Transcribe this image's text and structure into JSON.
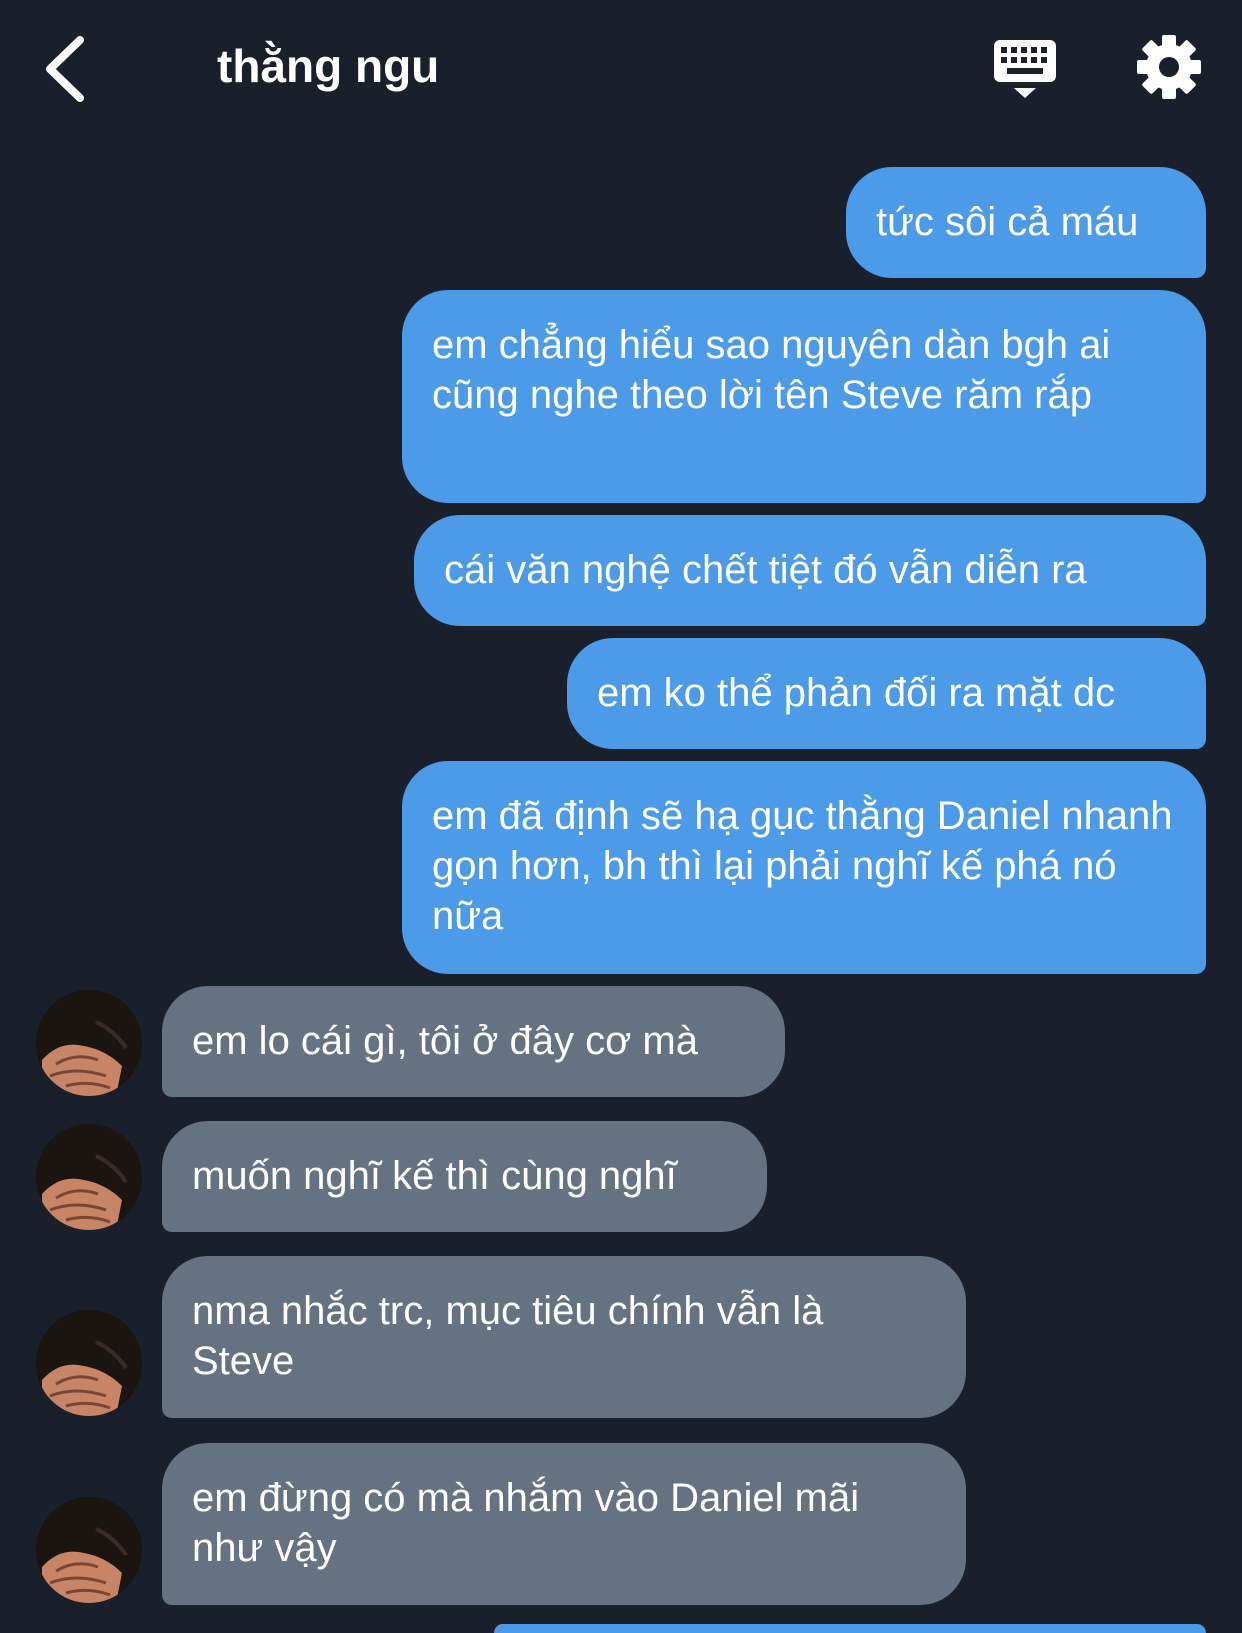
{
  "header": {
    "title": "thằng ngu",
    "back_icon": "chevron-left-icon",
    "keyboard_icon": "keyboard-icon",
    "settings_icon": "gear-icon"
  },
  "colors": {
    "background": "#19202b",
    "sent_bubble": "#4b9be8",
    "received_bubble": "#657281",
    "text": "#ffffff"
  },
  "messages": [
    {
      "sender": "me",
      "text": "tức sôi cả máu"
    },
    {
      "sender": "me",
      "text": "em chẳng hiểu sao nguyên dàn bgh ai cũng nghe theo lời tên Steve răm rắp"
    },
    {
      "sender": "me",
      "text": "cái văn nghệ chết tiệt đó vẫn diễn ra"
    },
    {
      "sender": "me",
      "text": "em ko thể phản đối ra mặt dc"
    },
    {
      "sender": "me",
      "text": "em đã định sẽ hạ gục thằng Daniel nhanh gọn hơn, bh thì lại phải nghĩ kế phá nó nữa"
    },
    {
      "sender": "them",
      "text": "em lo cái gì, tôi ở đây cơ mà"
    },
    {
      "sender": "them",
      "text": "muốn nghĩ kế thì cùng nghĩ"
    },
    {
      "sender": "them",
      "text": "nma nhắc trc, mục tiêu chính vẫn là Steve"
    },
    {
      "sender": "them",
      "text": "em đừng có mà nhắm vào Daniel mãi như vậy"
    }
  ]
}
